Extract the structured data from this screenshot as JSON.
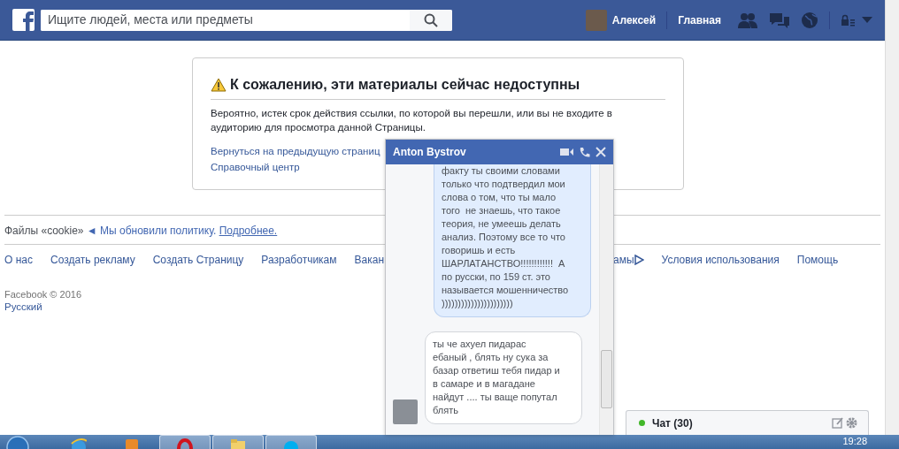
{
  "header": {
    "search": {
      "placeholder": "Ищите людей, места или предметы"
    },
    "user": {
      "name": "Алексей"
    },
    "nav": [
      "Главная"
    ]
  },
  "notice": {
    "title": "К сожалению, эти материалы сейчас недоступны",
    "body": "Вероятно, истек срок действия ссылки, по которой вы перешли, или вы не входите в аудиторию для просмотра данной Страницы.",
    "links": [
      "Вернуться на предыдущую страниц",
      "Справочный центр"
    ]
  },
  "cookie": {
    "prefix": "Файлы «cookie»",
    "arrow": "◄",
    "text": "Мы обновили политику.",
    "link": "Подробнее."
  },
  "footer": {
    "links_left": [
      "О нас",
      "Создать рекламу",
      "Создать Страницу",
      "Разработчикам",
      "Вакан"
    ],
    "links_right": [
      {
        "label": "амы",
        "adchoices": true
      },
      {
        "label": "Условия использования",
        "adchoices": false
      },
      {
        "label": "Помощь",
        "adchoices": false
      }
    ],
    "copyright": "Facebook © 2016",
    "language": "Русский"
  },
  "chat_window": {
    "title": "Anton Bystrov",
    "messages": [
      {
        "kind": "sent",
        "text": "факту ты своими словами\nтолько что подтвердил мои\nслова о том, что ты мало\nтого  не знаешь, что такое\nтеория, не умеешь делать\nанализ. Поэтому все то что\nговоришь и есть\nШАРЛАТАНСТВО!!!!!!!!!!!!  А\nпо русски, по 159 ст. это\nназывается мошенничество\n))))))))))))))))))))))"
      },
      {
        "kind": "received",
        "text": "ты че ахуел пидарас\nебаный , блять ну сука за\nбазар ответиш тебя пидар и\nв самаре и в магадане\nнайдут .... ты ваще попутал\nблять"
      }
    ]
  },
  "chat_bar": {
    "label": "Чат (30)",
    "online": true
  },
  "taskbar": {
    "apps": [
      {
        "kind": "ie",
        "running": false
      },
      {
        "kind": "app",
        "running": false
      },
      {
        "kind": "opera",
        "running": true
      },
      {
        "kind": "folder",
        "running": true
      },
      {
        "kind": "skype",
        "running": true
      }
    ],
    "clock": "19:28"
  }
}
